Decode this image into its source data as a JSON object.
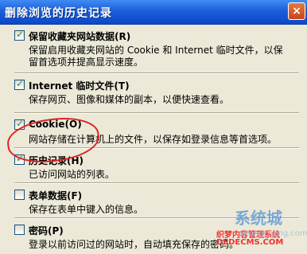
{
  "window": {
    "title": "删除浏览的历史记录",
    "close_label": "×"
  },
  "options": [
    {
      "label": "保留收藏夹网站数据(R)",
      "checked": true,
      "description": "保留启用收藏夹网站的 Cookie 和 Internet 临时文件，以保留首选项并提高显示速度。"
    },
    {
      "label": "Internet 临时文件(T)",
      "checked": true,
      "description": "保存网页、图像和媒体的副本，以便快速查看。"
    },
    {
      "label": "Cookie(O)",
      "checked": true,
      "description": "网站存储在计算机上的文件，以保存如登录信息等首选项。"
    },
    {
      "label": "历史记录(H)",
      "checked": true,
      "description": "已访问网站的列表。"
    },
    {
      "label": "表单数据(F)",
      "checked": false,
      "description": "保存在表单中键入的信息。"
    },
    {
      "label": "密码(P)",
      "checked": false,
      "description": "登录以前访问过的网站时，自动填充保存的密码。"
    }
  ],
  "watermark": {
    "logo_text": "系统城",
    "dede_line1": "织梦内容管理系统",
    "dede_line2": "DEDECMS.COM",
    "site": "xitongcheng.com"
  },
  "colors": {
    "title_bar": "#1c5fd9",
    "panel": "#ece9d8",
    "annotation": "#dd2222",
    "check": "#21a121"
  }
}
